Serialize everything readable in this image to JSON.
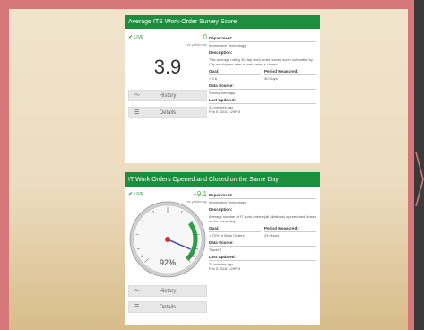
{
  "card1": {
    "title": "Average ITS Work-Order Survey Score",
    "live": "LIVE",
    "delta_value": "0",
    "delta_sub": "vs yesterday",
    "value": "3.9",
    "history_label": "History",
    "details_label": "Details",
    "department_label": "Department:",
    "department": "Information Technology",
    "description_label": "Description:",
    "description": "This average rolling 30 day work-order survey score submitted by City employees after a work order is closed.",
    "goal_label": "Goal:",
    "goal": "> 3.6",
    "period_label": "Period Measured:",
    "period": "30 Days",
    "source_label": "Data Source:",
    "source": "Survey form app",
    "updated_label": "Last Updated:",
    "updated_ago": "33 minutes ago",
    "updated_date": "Feb 5 2016 4:29PM"
  },
  "card2": {
    "title": "IT Work Orders Opened and Closed on the Same Day",
    "live": "LIVE",
    "delta_value": "+9.1",
    "delta_sub": "vs yesterday",
    "gauge_value": "92%",
    "gauge_fraction": 0.92,
    "gauge_min": "0",
    "gauge_max": "100",
    "history_label": "History",
    "details_label": "Details",
    "department_label": "Department:",
    "department": "Information Technology",
    "description_label": "Description:",
    "description": "Average number of IT work-orders (all divisions) opened and closed on the same day.",
    "goal_label": "Goal:",
    "goal": "> 70% of Work Orders",
    "period_label": "Period Measured:",
    "period": "24 Hours",
    "source_label": "Data Source:",
    "source": "TrackIT",
    "updated_label": "Last Updated:",
    "updated_ago": "33 minutes ago",
    "updated_date": "Feb 5 2016 4:29PM"
  },
  "colors": {
    "header": "#1e8e3e",
    "positive": "#4caf50",
    "frame": "#d6787a",
    "needle": "#3f51b5"
  }
}
